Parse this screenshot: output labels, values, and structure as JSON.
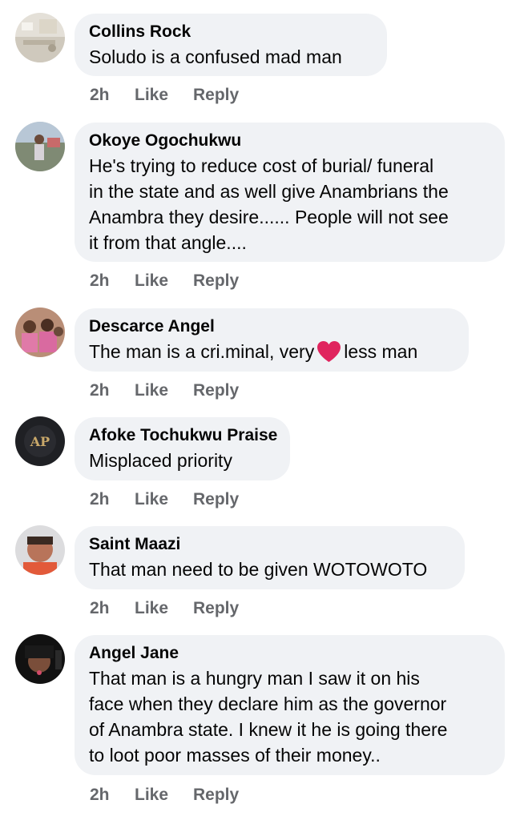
{
  "comments": [
    {
      "author": "Collins Rock",
      "lines": [
        "Soludo is a confused mad man"
      ],
      "time": "2h",
      "like_label": "Like",
      "reply_label": "Reply"
    },
    {
      "author": "Okoye Ogochukwu",
      "lines": [
        "He's trying to reduce cost of burial/ funeral",
        "in the state and as well give Anambrians the",
        "Anambra they desire...... People will not see",
        "it from that angle...."
      ],
      "time": "2h",
      "like_label": "Like",
      "reply_label": "Reply"
    },
    {
      "author": "Descarce Angel",
      "text_before_emoji": "The man is a cri.minal, very",
      "emoji": "red-heart",
      "text_after_emoji": "less man",
      "time": "2h",
      "like_label": "Like",
      "reply_label": "Reply"
    },
    {
      "author": "Afoke Tochukwu Praise",
      "lines": [
        "Misplaced priority"
      ],
      "time": "2h",
      "like_label": "Like",
      "reply_label": "Reply"
    },
    {
      "author": "Saint Maazi",
      "lines": [
        "That man need to be given WOTOWOTO"
      ],
      "time": "2h",
      "like_label": "Like",
      "reply_label": "Reply"
    },
    {
      "author": "Angel Jane",
      "lines": [
        "That man is a hungry man I saw it on his",
        "face when they declare him as the governor",
        "of Anambra state. I knew it he is going there",
        "to loot poor masses of their money.."
      ],
      "time": "2h",
      "like_label": "Like",
      "reply_label": "Reply"
    }
  ],
  "colors": {
    "bubble_bg": "#f0f2f5",
    "meta_text": "#65676b",
    "heart": "#e0245e"
  }
}
